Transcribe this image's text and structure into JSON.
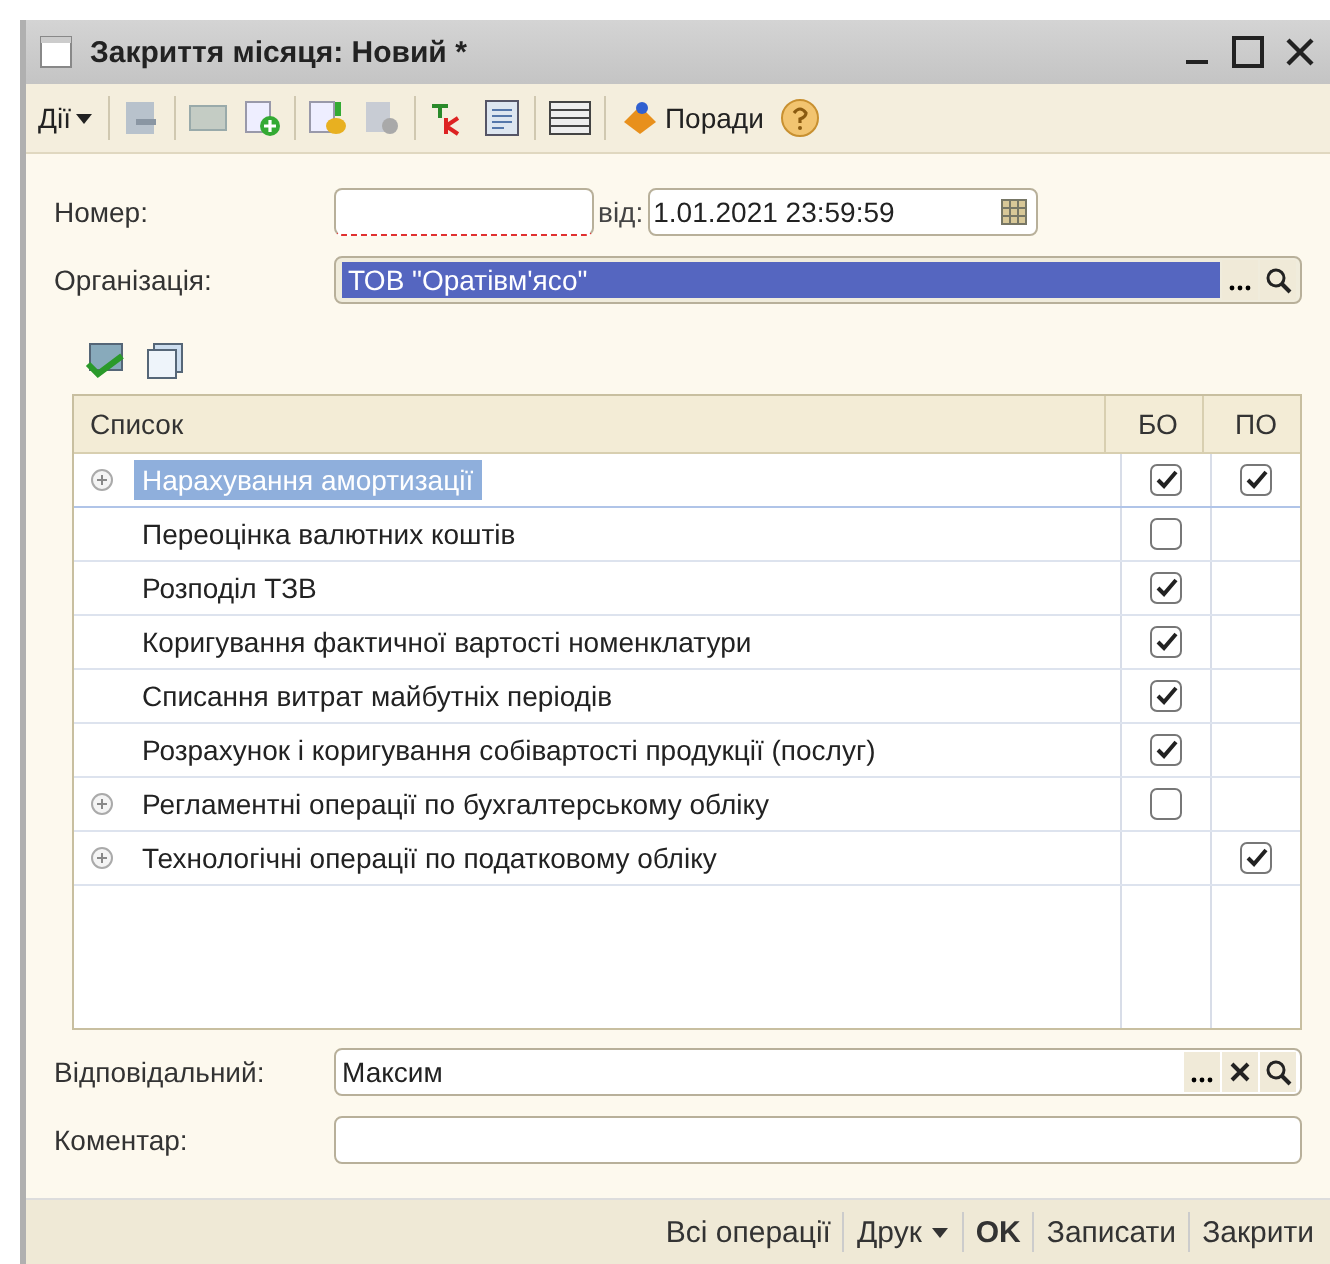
{
  "window": {
    "title": "Закриття місяця: Новий *"
  },
  "toolbar": {
    "actions": "Дії",
    "tips": "Поради"
  },
  "fields": {
    "number": {
      "label": "Номер:"
    },
    "date_label": "від:",
    "date": "1.01.2021 23:59:59",
    "organization": {
      "label": "Організація:",
      "value": "ТОВ \"Оратівм'ясо\""
    }
  },
  "table": {
    "columns": [
      "Список",
      "БО",
      "ПО"
    ],
    "rows": [
      {
        "name": "Нарахування амортизації",
        "expandable": true,
        "selected": true,
        "bo": true,
        "po": true
      },
      {
        "name": "Переоцінка валютних коштів",
        "expandable": false,
        "selected": false,
        "bo": false
      },
      {
        "name": "Розподіл ТЗВ",
        "expandable": false,
        "selected": false,
        "bo": true
      },
      {
        "name": "Коригування фактичної вартості номенклатури",
        "expandable": false,
        "selected": false,
        "bo": true
      },
      {
        "name": "Списання витрат майбутніх періодів",
        "expandable": false,
        "selected": false,
        "bo": true
      },
      {
        "name": "Розрахунок і коригування собівартості продукції (послуг)",
        "expandable": false,
        "selected": false,
        "bo": true
      },
      {
        "name": "Регламентні операції по бухгалтерському обліку",
        "expandable": true,
        "selected": false,
        "bo": false
      },
      {
        "name": "Технологічні операції по податковому обліку",
        "expandable": true,
        "selected": false,
        "po": true
      }
    ]
  },
  "responsible": {
    "label": "Відповідальний:",
    "value": "Максим"
  },
  "comment": {
    "label": "Коментар:"
  },
  "footer": [
    {
      "label": "Всі операції",
      "kind": "plain"
    },
    {
      "label": "Друк",
      "kind": "menu"
    },
    {
      "label": "OK",
      "kind": "default"
    },
    {
      "label": "Записати",
      "kind": "plain"
    },
    {
      "label": "Закрити",
      "kind": "plain"
    }
  ]
}
